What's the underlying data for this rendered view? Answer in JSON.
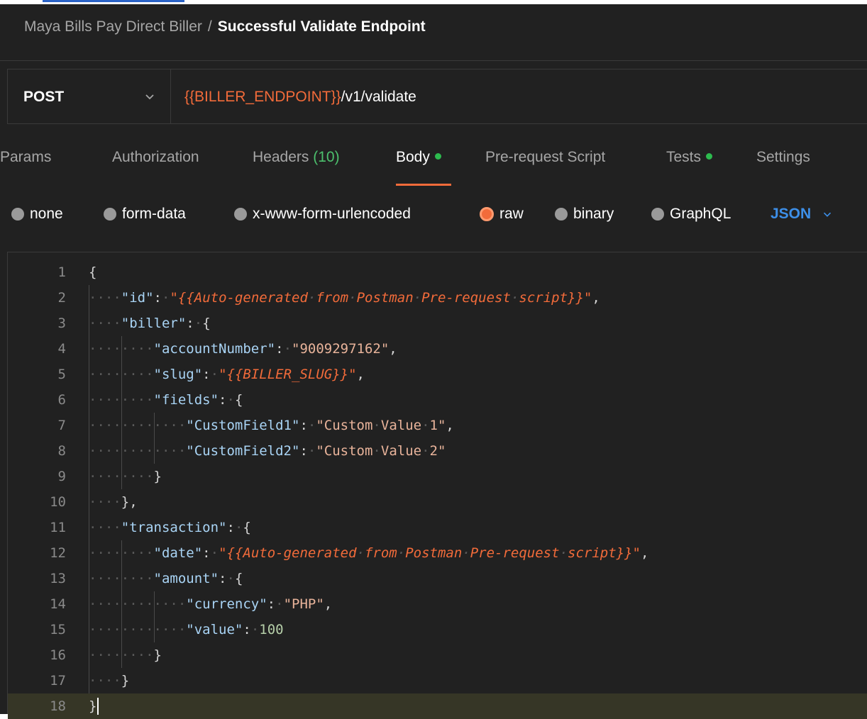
{
  "breadcrumb": {
    "collection": "Maya Bills Pay Direct Biller",
    "separator": "/",
    "request": "Successful Validate Endpoint"
  },
  "request": {
    "method": "POST",
    "url_variable": "{{BILLER_ENDPOINT}}",
    "url_path": "/v1/validate"
  },
  "tabs": [
    {
      "label": "Params"
    },
    {
      "label": "Authorization"
    },
    {
      "label": "Headers",
      "count": "(10)"
    },
    {
      "label": "Body",
      "indicator": true,
      "active": true
    },
    {
      "label": "Pre-request Script"
    },
    {
      "label": "Tests",
      "indicator": true
    },
    {
      "label": "Settings"
    }
  ],
  "body_types": [
    {
      "label": "none",
      "selected": false
    },
    {
      "label": "form-data",
      "selected": false
    },
    {
      "label": "x-www-form-urlencoded",
      "selected": false
    },
    {
      "label": "raw",
      "selected": true
    },
    {
      "label": "binary",
      "selected": false
    },
    {
      "label": "GraphQL",
      "selected": false
    }
  ],
  "format": "JSON",
  "colors": {
    "accent": "#f26b3a",
    "indicator": "#2dbb4e",
    "format_link": "#3d8fe8",
    "background": "#212121"
  },
  "editor": {
    "line_numbers": [
      "1",
      "2",
      "3",
      "4",
      "5",
      "6",
      "7",
      "8",
      "9",
      "10",
      "11",
      "12",
      "13",
      "14",
      "15",
      "16",
      "17",
      "18"
    ],
    "lines": [
      "{",
      "    \"id\": \"{{Auto-generated from Postman Pre-request script}}\",",
      "    \"biller\": {",
      "        \"accountNumber\": \"9009297162\",",
      "        \"slug\": \"{{BILLER_SLUG}}\",",
      "        \"fields\": {",
      "            \"CustomField1\": \"Custom Value 1\",",
      "            \"CustomField2\": \"Custom Value 2\"",
      "        }",
      "    },",
      "    \"transaction\": {",
      "        \"date\": \"{{Auto-generated from Postman Pre-request script}}\",",
      "        \"amount\": {",
      "            \"currency\": \"PHP\",",
      "            \"value\": 100",
      "        }",
      "    }",
      "}"
    ]
  }
}
